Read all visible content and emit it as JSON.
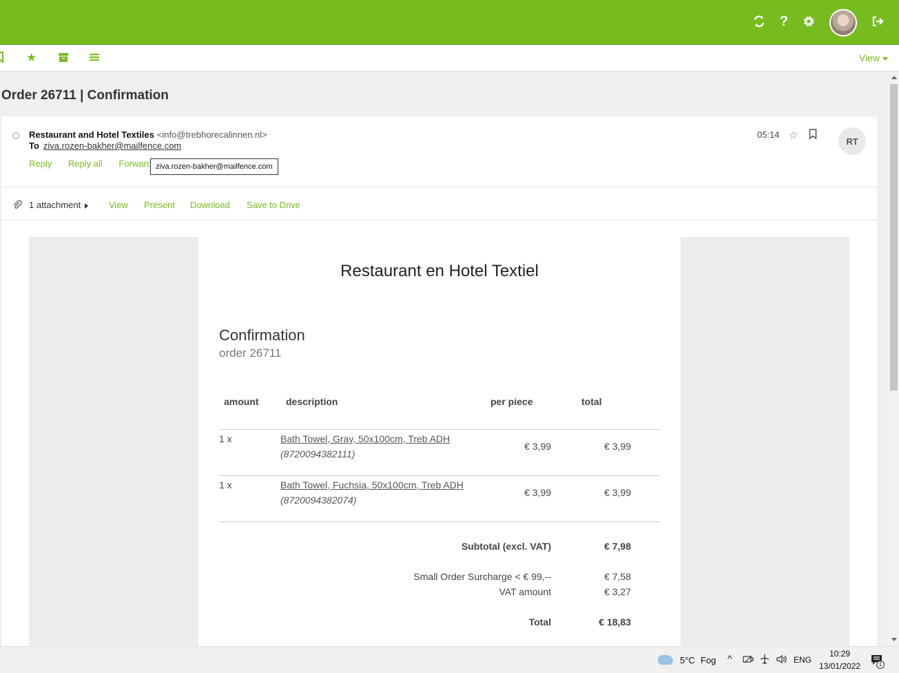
{
  "header": {
    "icons": [
      "refresh-icon",
      "help-icon",
      "settings-icon",
      "avatar",
      "logout-icon"
    ],
    "accent": "#77bc1f"
  },
  "toolbar": {
    "icons": [
      "bookmark-icon",
      "star-icon",
      "archive-icon",
      "menu-icon"
    ],
    "view_label": "View"
  },
  "message": {
    "subject": "Order 26711 | Confirmation",
    "sender_name": "Restaurant and Hotel Textiles",
    "sender_email": "<info@trebhorecalinnen.nl>",
    "to_label": "To",
    "to_address": "ziva.rozen-bakher@mailfence.com",
    "time": "05:14",
    "initials": "RT",
    "actions": {
      "reply": "Reply",
      "reply_all": "Reply all",
      "forward": "Forward"
    },
    "tooltip": "ziva.rozen-bakher@mailfence.com"
  },
  "attachments": {
    "count_label": "1 attachment",
    "view": "View",
    "present": "Present",
    "download": "Download",
    "save": "Save to Drive"
  },
  "email_body": {
    "company": "Restaurant en Hotel Textiel",
    "title": "Confirmation",
    "order_label": "order 26711",
    "columns": {
      "amount": "amount",
      "description": "description",
      "per_piece": "per piece",
      "total": "total"
    },
    "items": [
      {
        "amount": "1 x",
        "description": "Bath Towel, Gray, 50x100cm, Treb ADH",
        "sku": "(8720094382111)",
        "per_piece": "€ 3,99",
        "total": "€ 3,99"
      },
      {
        "amount": "1 x",
        "description": "Bath Towel, Fuchsia, 50x100cm, Treb ADH",
        "sku": "(8720094382074)",
        "per_piece": "€ 3,99",
        "total": "€ 3,99"
      }
    ],
    "subtotal_label": "Subtotal (excl. VAT)",
    "subtotal": "€ 7,98",
    "surcharge_label": "Small Order Surcharge < € 99,--",
    "surcharge": "€ 7,58",
    "vat_label": "VAT amount",
    "vat": "€ 3,27",
    "total_label": "Total",
    "total": "€ 18,83"
  },
  "taskbar": {
    "temperature": "5°C",
    "weather": "Fog",
    "language": "ENG",
    "time": "10:29",
    "date": "13/01/2022",
    "notification_count": "1"
  }
}
